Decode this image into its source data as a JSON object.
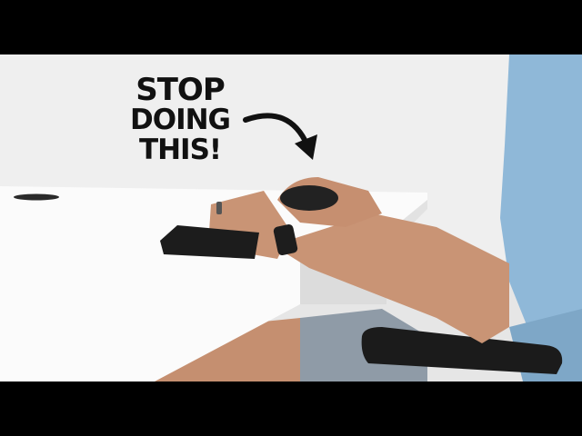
{
  "caption": {
    "line1": "STOP",
    "line2": "DOING",
    "line3": "THIS!"
  },
  "colors": {
    "background": "#ededed",
    "desk": "#fbfbfb",
    "shirt": "#8db7d6",
    "shorts": "#8d9aa6",
    "skin": "#c89273",
    "keyboard": "#1c1c1c",
    "arrow": "#111111"
  },
  "icons": {
    "arrow": "curved-arrow-icon"
  }
}
